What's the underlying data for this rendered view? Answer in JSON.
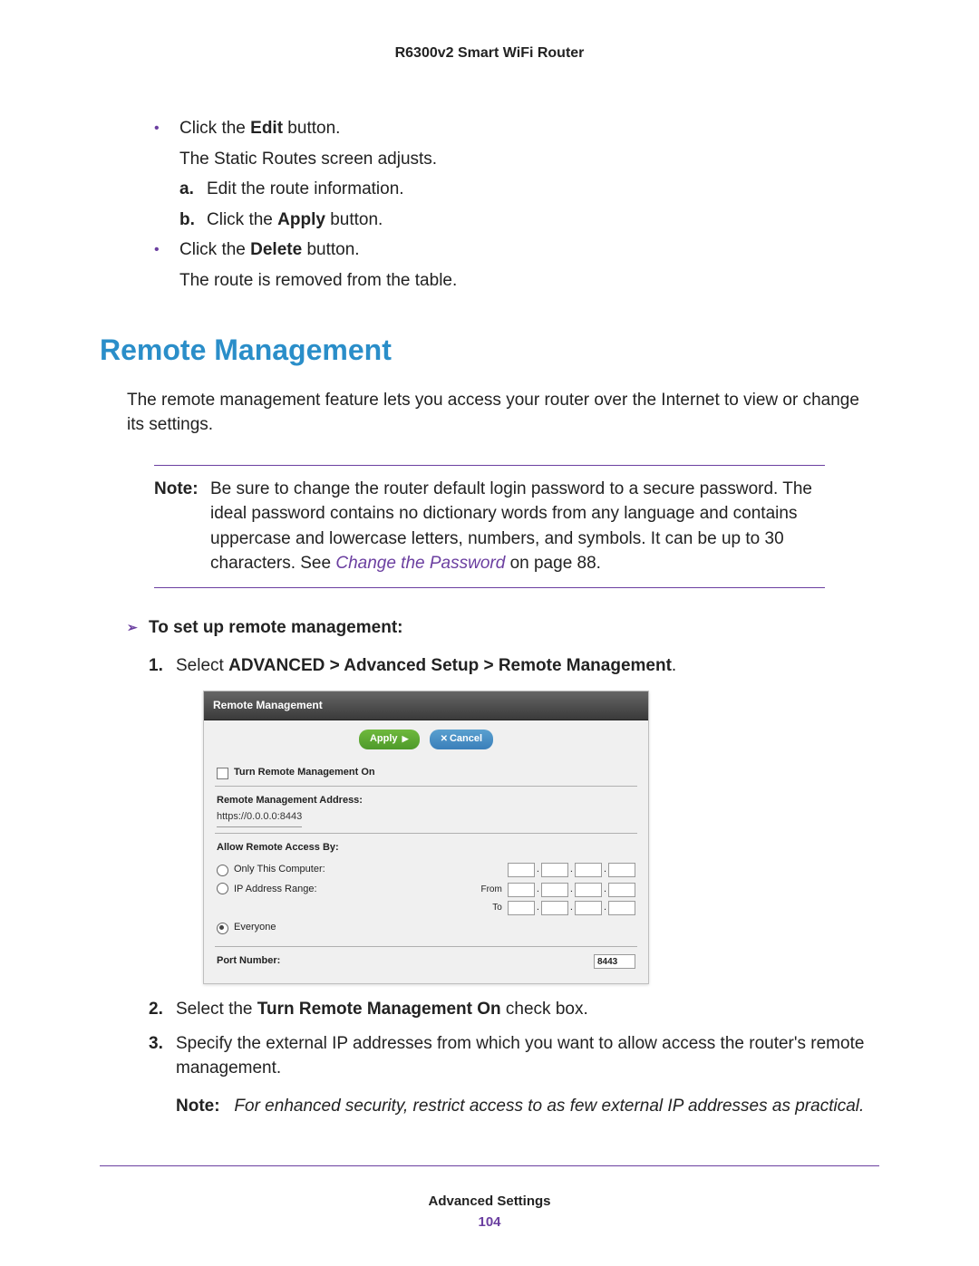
{
  "header": {
    "product": "R6300v2 Smart WiFi Router"
  },
  "intro_list": {
    "b1_pre": "Click the ",
    "b1_bold": "Edit",
    "b1_post": " button.",
    "b1_sub": "The Static Routes screen adjusts.",
    "a_label": "a.",
    "a_text": "Edit the route information.",
    "b_label": "b.",
    "b_pre": "Click the ",
    "b_bold": "Apply",
    "b_post": " button.",
    "b2_pre": "Click the ",
    "b2_bold": "Delete",
    "b2_post": " button.",
    "b2_sub": "The route is removed from the table."
  },
  "section_title": "Remote Management",
  "intro": "The remote management feature lets you access your router over the Internet to view or change its settings.",
  "note": {
    "label": "Note:",
    "body1": "Be sure to change the router default login password to a secure password. The ideal password contains no dictionary words from any language and contains uppercase and lowercase letters, numbers, and symbols. It can be up to 30 characters. See ",
    "link": "Change the Password",
    "body2": " on page 88."
  },
  "procedure": {
    "heading": "To set up remote management:",
    "s1_label": "1.",
    "s1_pre": "Select ",
    "s1_bold": "ADVANCED > Advanced Setup > Remote Management",
    "s1_post": ".",
    "s2_label": "2.",
    "s2_pre": "Select the ",
    "s2_bold": "Turn Remote Management On",
    "s2_post": " check box.",
    "s3_label": "3.",
    "s3_text": "Specify the external IP addresses from which you want to allow access the router's remote management.",
    "note_label": "Note:",
    "note_body": "For enhanced security, restrict access to as few external IP addresses as practical."
  },
  "panel": {
    "title": "Remote Management",
    "apply": "Apply",
    "cancel": "Cancel",
    "turn_on": "Turn Remote Management On",
    "addr_label": "Remote Management Address:",
    "addr_value": "https://0.0.0.0:8443",
    "allow_label": "Allow Remote Access By:",
    "only_this": "Only This Computer:",
    "ip_range": "IP Address Range:",
    "from": "From",
    "to": "To",
    "everyone": "Everyone",
    "port_label": "Port Number:",
    "port_value": "8443"
  },
  "footer": {
    "text": "Advanced Settings",
    "page": "104"
  }
}
